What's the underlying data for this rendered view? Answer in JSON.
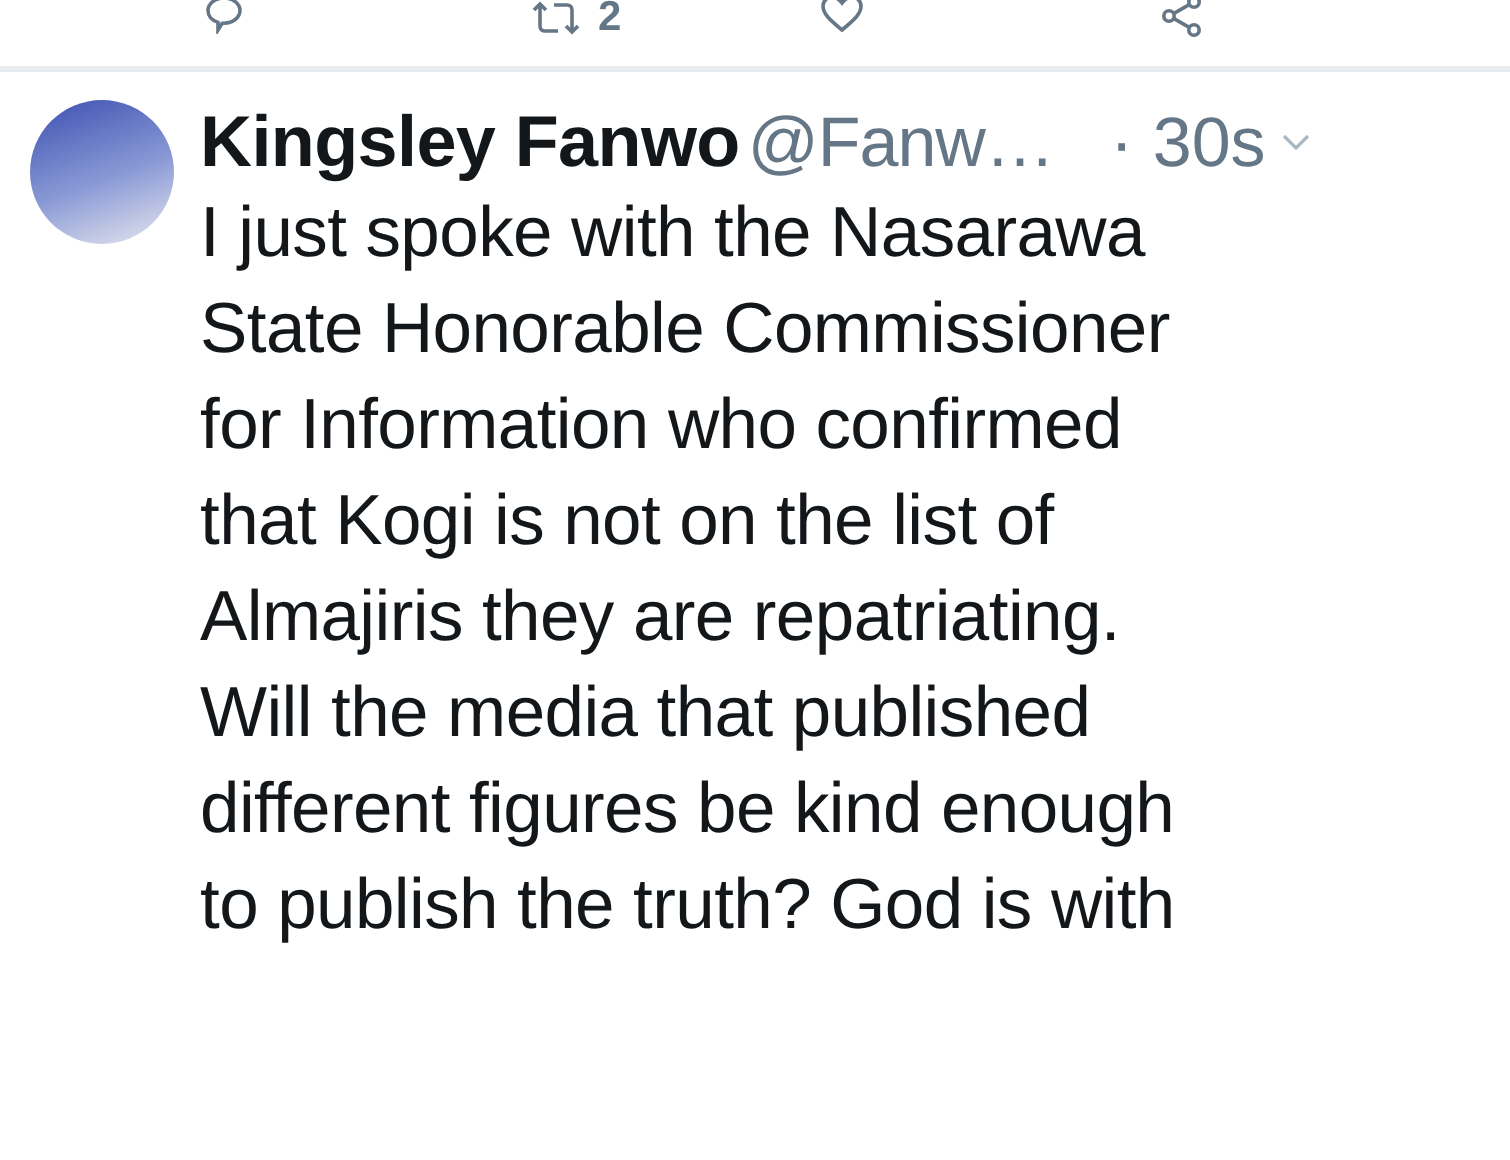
{
  "previous_tweet": {
    "actions": [
      {
        "kind": "reply"
      },
      {
        "kind": "retweet",
        "count": "2"
      },
      {
        "kind": "like"
      },
      {
        "kind": "share"
      }
    ]
  },
  "tweet": {
    "name": "Kingsley Fanwo",
    "handle": "@Fanw…",
    "time": "· 30s",
    "text": "I just spoke with the Nasarawa\nState Honorable Commissioner\nfor Information who confirmed\nthat Kogi is not on the list of\nAlmajiris they are repatriating.\nWill the media that published\ndifferent figures be kind enough\nto publish the truth? God is with"
  }
}
